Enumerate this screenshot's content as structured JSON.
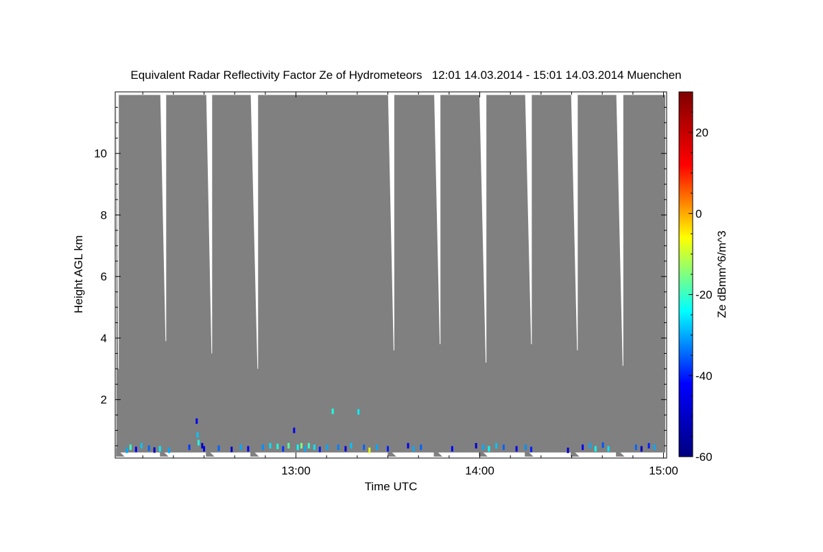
{
  "chart_data": {
    "type": "heatmap",
    "title": "Equivalent Radar Reflectivity Factor Ze of Hydrometeors   12:01 14.03.2014 - 15:01 14.03.2014 Muenchen",
    "xlabel": "Time UTC",
    "ylabel": "Height AGL km",
    "x_unit": "hours UTC",
    "xlim": [
      12.0167,
      15.0167
    ],
    "ylim": [
      0.1,
      12.0
    ],
    "x_ticks": [
      {
        "value": 13.0,
        "label": "13:00"
      },
      {
        "value": 14.0,
        "label": "14:00"
      },
      {
        "value": 15.0,
        "label": "15:00"
      }
    ],
    "y_ticks": [
      {
        "value": 2,
        "label": "2"
      },
      {
        "value": 4,
        "label": "4"
      },
      {
        "value": 6,
        "label": "6"
      },
      {
        "value": 8,
        "label": "8"
      },
      {
        "value": 10,
        "label": "10"
      }
    ],
    "colorbar": {
      "label": "Ze dBmm^6/m^3",
      "range": [
        -60,
        30
      ],
      "ticks": [
        {
          "value": -60,
          "label": "-60"
        },
        {
          "value": -40,
          "label": "-40"
        },
        {
          "value": -20,
          "label": "-20"
        },
        {
          "value": 0,
          "label": "0"
        },
        {
          "value": 20,
          "label": "20"
        }
      ],
      "colormap": [
        "#00007f",
        "#0000ff",
        "#00ffff",
        "#ffff00",
        "#ff0000",
        "#7f0000"
      ]
    },
    "no_signal_color": "#808080",
    "no_data_color": "#ffffff",
    "gaps": [
      {
        "t0": 12.023,
        "t1": 12.036,
        "top_km": 11.9,
        "bottom_km": 3.0,
        "start_width_h": 0.012
      },
      {
        "t0": 12.262,
        "t1": 12.294,
        "top_km": 11.9,
        "bottom_km": 3.9,
        "start_width_h": 0.032
      },
      {
        "t0": 12.512,
        "t1": 12.544,
        "top_km": 11.9,
        "bottom_km": 3.5,
        "start_width_h": 0.032
      },
      {
        "t0": 12.754,
        "t1": 12.794,
        "top_km": 11.9,
        "bottom_km": 3.0,
        "start_width_h": 0.04
      },
      {
        "t0": 13.501,
        "t1": 13.535,
        "top_km": 11.9,
        "bottom_km": 3.6,
        "start_width_h": 0.034
      },
      {
        "t0": 13.752,
        "t1": 13.786,
        "top_km": 11.9,
        "bottom_km": 3.8,
        "start_width_h": 0.034
      },
      {
        "t0": 13.998,
        "t1": 14.036,
        "top_km": 11.9,
        "bottom_km": 3.2,
        "start_width_h": 0.038
      },
      {
        "t0": 14.247,
        "t1": 14.283,
        "top_km": 11.9,
        "bottom_km": 3.8,
        "start_width_h": 0.036
      },
      {
        "t0": 14.497,
        "t1": 14.533,
        "top_km": 11.9,
        "bottom_km": 3.6,
        "start_width_h": 0.036
      },
      {
        "t0": 14.743,
        "t1": 14.781,
        "top_km": 11.9,
        "bottom_km": 3.1,
        "start_width_h": 0.038
      }
    ],
    "echoes": [
      {
        "t": 12.08,
        "h": 0.35,
        "ze": -30
      },
      {
        "t": 12.1,
        "h": 0.45,
        "ze": -20
      },
      {
        "t": 12.13,
        "h": 0.38,
        "ze": -42
      },
      {
        "t": 12.16,
        "h": 0.5,
        "ze": -28
      },
      {
        "t": 12.2,
        "h": 0.42,
        "ze": -35
      },
      {
        "t": 12.23,
        "h": 0.36,
        "ze": -48
      },
      {
        "t": 12.26,
        "h": 0.4,
        "ze": -25
      },
      {
        "t": 12.31,
        "h": 0.35,
        "ze": -30
      },
      {
        "t": 12.42,
        "h": 0.45,
        "ze": -38
      },
      {
        "t": 12.46,
        "h": 1.3,
        "ze": -45
      },
      {
        "t": 12.465,
        "h": 0.85,
        "ze": -28
      },
      {
        "t": 12.47,
        "h": 0.6,
        "ze": -22
      },
      {
        "t": 12.49,
        "h": 0.5,
        "ze": -50
      },
      {
        "t": 12.5,
        "h": 0.4,
        "ze": -45
      },
      {
        "t": 12.58,
        "h": 0.42,
        "ze": -35
      },
      {
        "t": 12.65,
        "h": 0.38,
        "ze": -50
      },
      {
        "t": 12.7,
        "h": 0.45,
        "ze": -30
      },
      {
        "t": 12.74,
        "h": 0.4,
        "ze": -42
      },
      {
        "t": 12.82,
        "h": 0.45,
        "ze": -32
      },
      {
        "t": 12.86,
        "h": 0.5,
        "ze": -26
      },
      {
        "t": 12.9,
        "h": 0.48,
        "ze": -22
      },
      {
        "t": 12.93,
        "h": 0.4,
        "ze": -38
      },
      {
        "t": 12.96,
        "h": 0.5,
        "ze": -18
      },
      {
        "t": 12.99,
        "h": 1.0,
        "ze": -44
      },
      {
        "t": 13.01,
        "h": 0.45,
        "ze": -24
      },
      {
        "t": 13.03,
        "h": 0.5,
        "ze": -15
      },
      {
        "t": 13.05,
        "h": 0.4,
        "ze": -30
      },
      {
        "t": 13.07,
        "h": 0.5,
        "ze": -20
      },
      {
        "t": 13.1,
        "h": 0.45,
        "ze": -26
      },
      {
        "t": 13.13,
        "h": 0.38,
        "ze": -40
      },
      {
        "t": 13.17,
        "h": 0.45,
        "ze": -30
      },
      {
        "t": 13.2,
        "h": 1.62,
        "ze": -22
      },
      {
        "t": 13.23,
        "h": 0.45,
        "ze": -33
      },
      {
        "t": 13.27,
        "h": 0.4,
        "ze": -46
      },
      {
        "t": 13.3,
        "h": 0.5,
        "ze": -28
      },
      {
        "t": 13.34,
        "h": 1.6,
        "ze": -25
      },
      {
        "t": 13.37,
        "h": 0.45,
        "ze": -35
      },
      {
        "t": 13.4,
        "h": 0.35,
        "ze": -8
      },
      {
        "t": 13.44,
        "h": 0.45,
        "ze": -30
      },
      {
        "t": 13.5,
        "h": 0.4,
        "ze": -40
      },
      {
        "t": 13.61,
        "h": 0.5,
        "ze": -45
      },
      {
        "t": 13.64,
        "h": 0.4,
        "ze": -30
      },
      {
        "t": 13.68,
        "h": 0.45,
        "ze": -35
      },
      {
        "t": 13.85,
        "h": 0.4,
        "ze": -42
      },
      {
        "t": 13.98,
        "h": 0.5,
        "ze": -48
      },
      {
        "t": 14.02,
        "h": 0.45,
        "ze": -30
      },
      {
        "t": 14.05,
        "h": 0.4,
        "ze": -24
      },
      {
        "t": 14.09,
        "h": 0.5,
        "ze": -28
      },
      {
        "t": 14.13,
        "h": 0.45,
        "ze": -35
      },
      {
        "t": 14.2,
        "h": 0.4,
        "ze": -45
      },
      {
        "t": 14.25,
        "h": 0.45,
        "ze": -32
      },
      {
        "t": 14.28,
        "h": 0.38,
        "ze": -40
      },
      {
        "t": 14.48,
        "h": 0.35,
        "ze": -48
      },
      {
        "t": 14.56,
        "h": 0.45,
        "ze": -42
      },
      {
        "t": 14.6,
        "h": 0.5,
        "ze": -30
      },
      {
        "t": 14.63,
        "h": 0.4,
        "ze": -24
      },
      {
        "t": 14.67,
        "h": 0.52,
        "ze": -36
      },
      {
        "t": 14.7,
        "h": 0.4,
        "ze": -26
      },
      {
        "t": 14.85,
        "h": 0.45,
        "ze": -35
      },
      {
        "t": 14.88,
        "h": 0.4,
        "ze": -50
      },
      {
        "t": 14.92,
        "h": 0.5,
        "ze": -40
      },
      {
        "t": 14.95,
        "h": 0.45,
        "ze": -30
      }
    ]
  }
}
